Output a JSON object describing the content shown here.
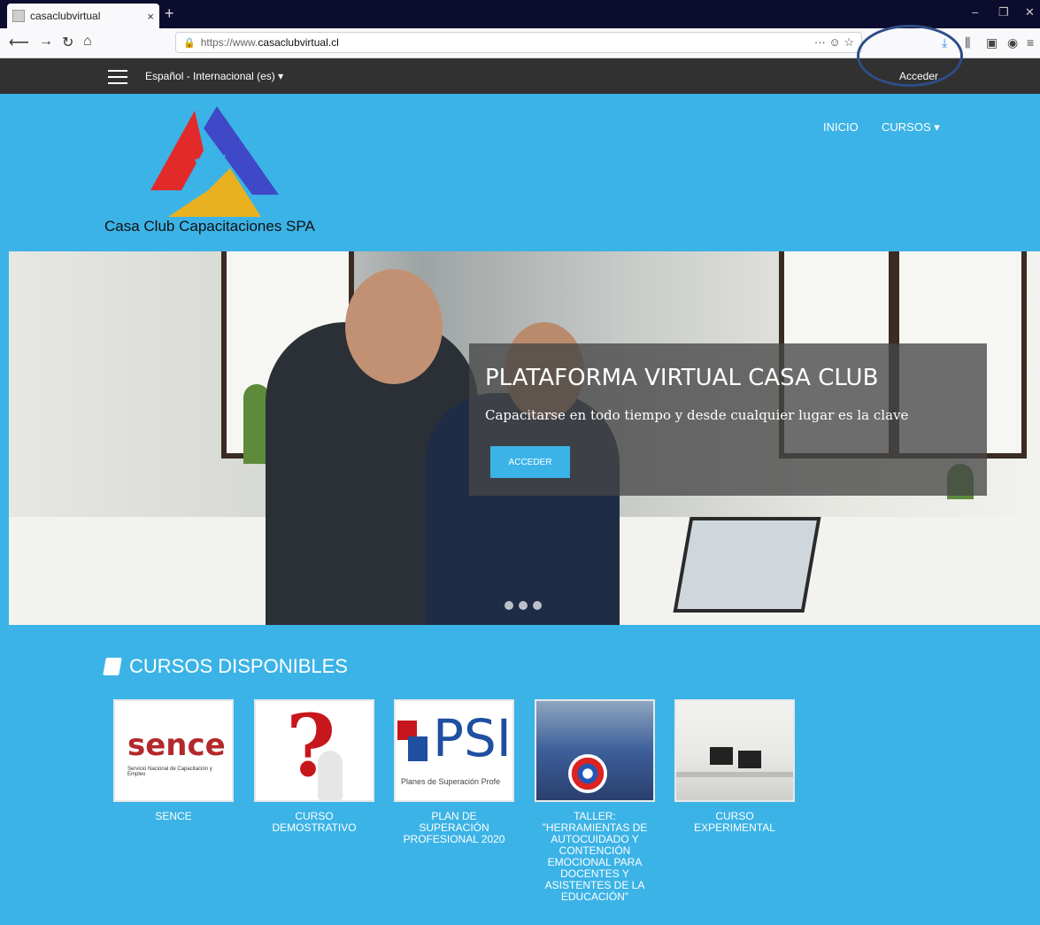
{
  "browser": {
    "tab_title": "casaclubvirtual",
    "tab_close": "×",
    "new_tab": "+",
    "url_prefix": "https://www.",
    "url_domain": "casaclubvirtual.cl",
    "url_actions": "··· ☺ ☆"
  },
  "site": {
    "language": "Español - Internacional (es) ▾",
    "login_link": "Acceder",
    "logo_text": "Casa Club Capacitaciones SPA",
    "menu": {
      "home": "INICIO",
      "courses": "CURSOS ▾"
    },
    "hero": {
      "title": "PLATAFORMA VIRTUAL CASA CLUB",
      "subtitle": "Capacitarse en todo tiempo y desde cualquier lugar es la clave",
      "button": "ACCEDER"
    },
    "courses_heading": "CURSOS DISPONIBLES",
    "courses": [
      {
        "label": "SENCE",
        "thumb_text": "sence",
        "thumb_sub": "Servicio Nacional de Capacitación y Empleo"
      },
      {
        "label": "CURSO DEMOSTRATIVO",
        "thumb_text": "?"
      },
      {
        "label": "PLAN DE SUPERACIÓN PROFESIONAL 2020",
        "thumb_text": "PSI",
        "thumb_sub": "Planes de Superación Profe"
      },
      {
        "label": "TALLER: \"HERRAMIENTAS DE AUTOCUIDADO Y CONTENCIÓN EMOCIONAL PARA DOCENTES Y ASISTENTES DE LA EDUCACIÓN\""
      },
      {
        "label": "CURSO EXPERIMENTAL"
      }
    ]
  },
  "colors": {
    "brand_blue": "#3bb3e6",
    "topbar": "#313131",
    "annotation_circle": "#2e4d86"
  }
}
